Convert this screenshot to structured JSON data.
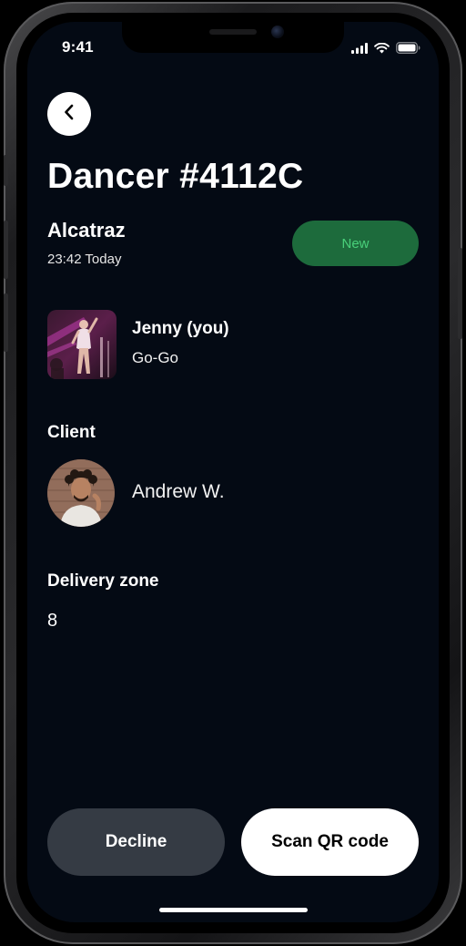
{
  "status_bar": {
    "time": "9:41",
    "icons": [
      "cellular-signal-icon",
      "wifi-icon",
      "battery-icon"
    ]
  },
  "header": {
    "back_icon": "chevron-left-icon",
    "title": "Dancer #4112C"
  },
  "booking": {
    "venue": "Alcatraz",
    "timestamp": "23:42 Today",
    "status_badge": "New",
    "status_color": "#1d6b3c",
    "status_text_color": "#49d07a"
  },
  "dancer": {
    "name": "Jenny (you)",
    "role": "Go-Go"
  },
  "client": {
    "section_label": "Client",
    "name": "Andrew W."
  },
  "delivery": {
    "section_label": "Delivery zone",
    "value": "8"
  },
  "actions": {
    "decline_label": "Decline",
    "scan_label": "Scan QR code"
  },
  "colors": {
    "screen_background": "#040a14",
    "decline_button": "#353b44",
    "scan_button": "#ffffff"
  }
}
